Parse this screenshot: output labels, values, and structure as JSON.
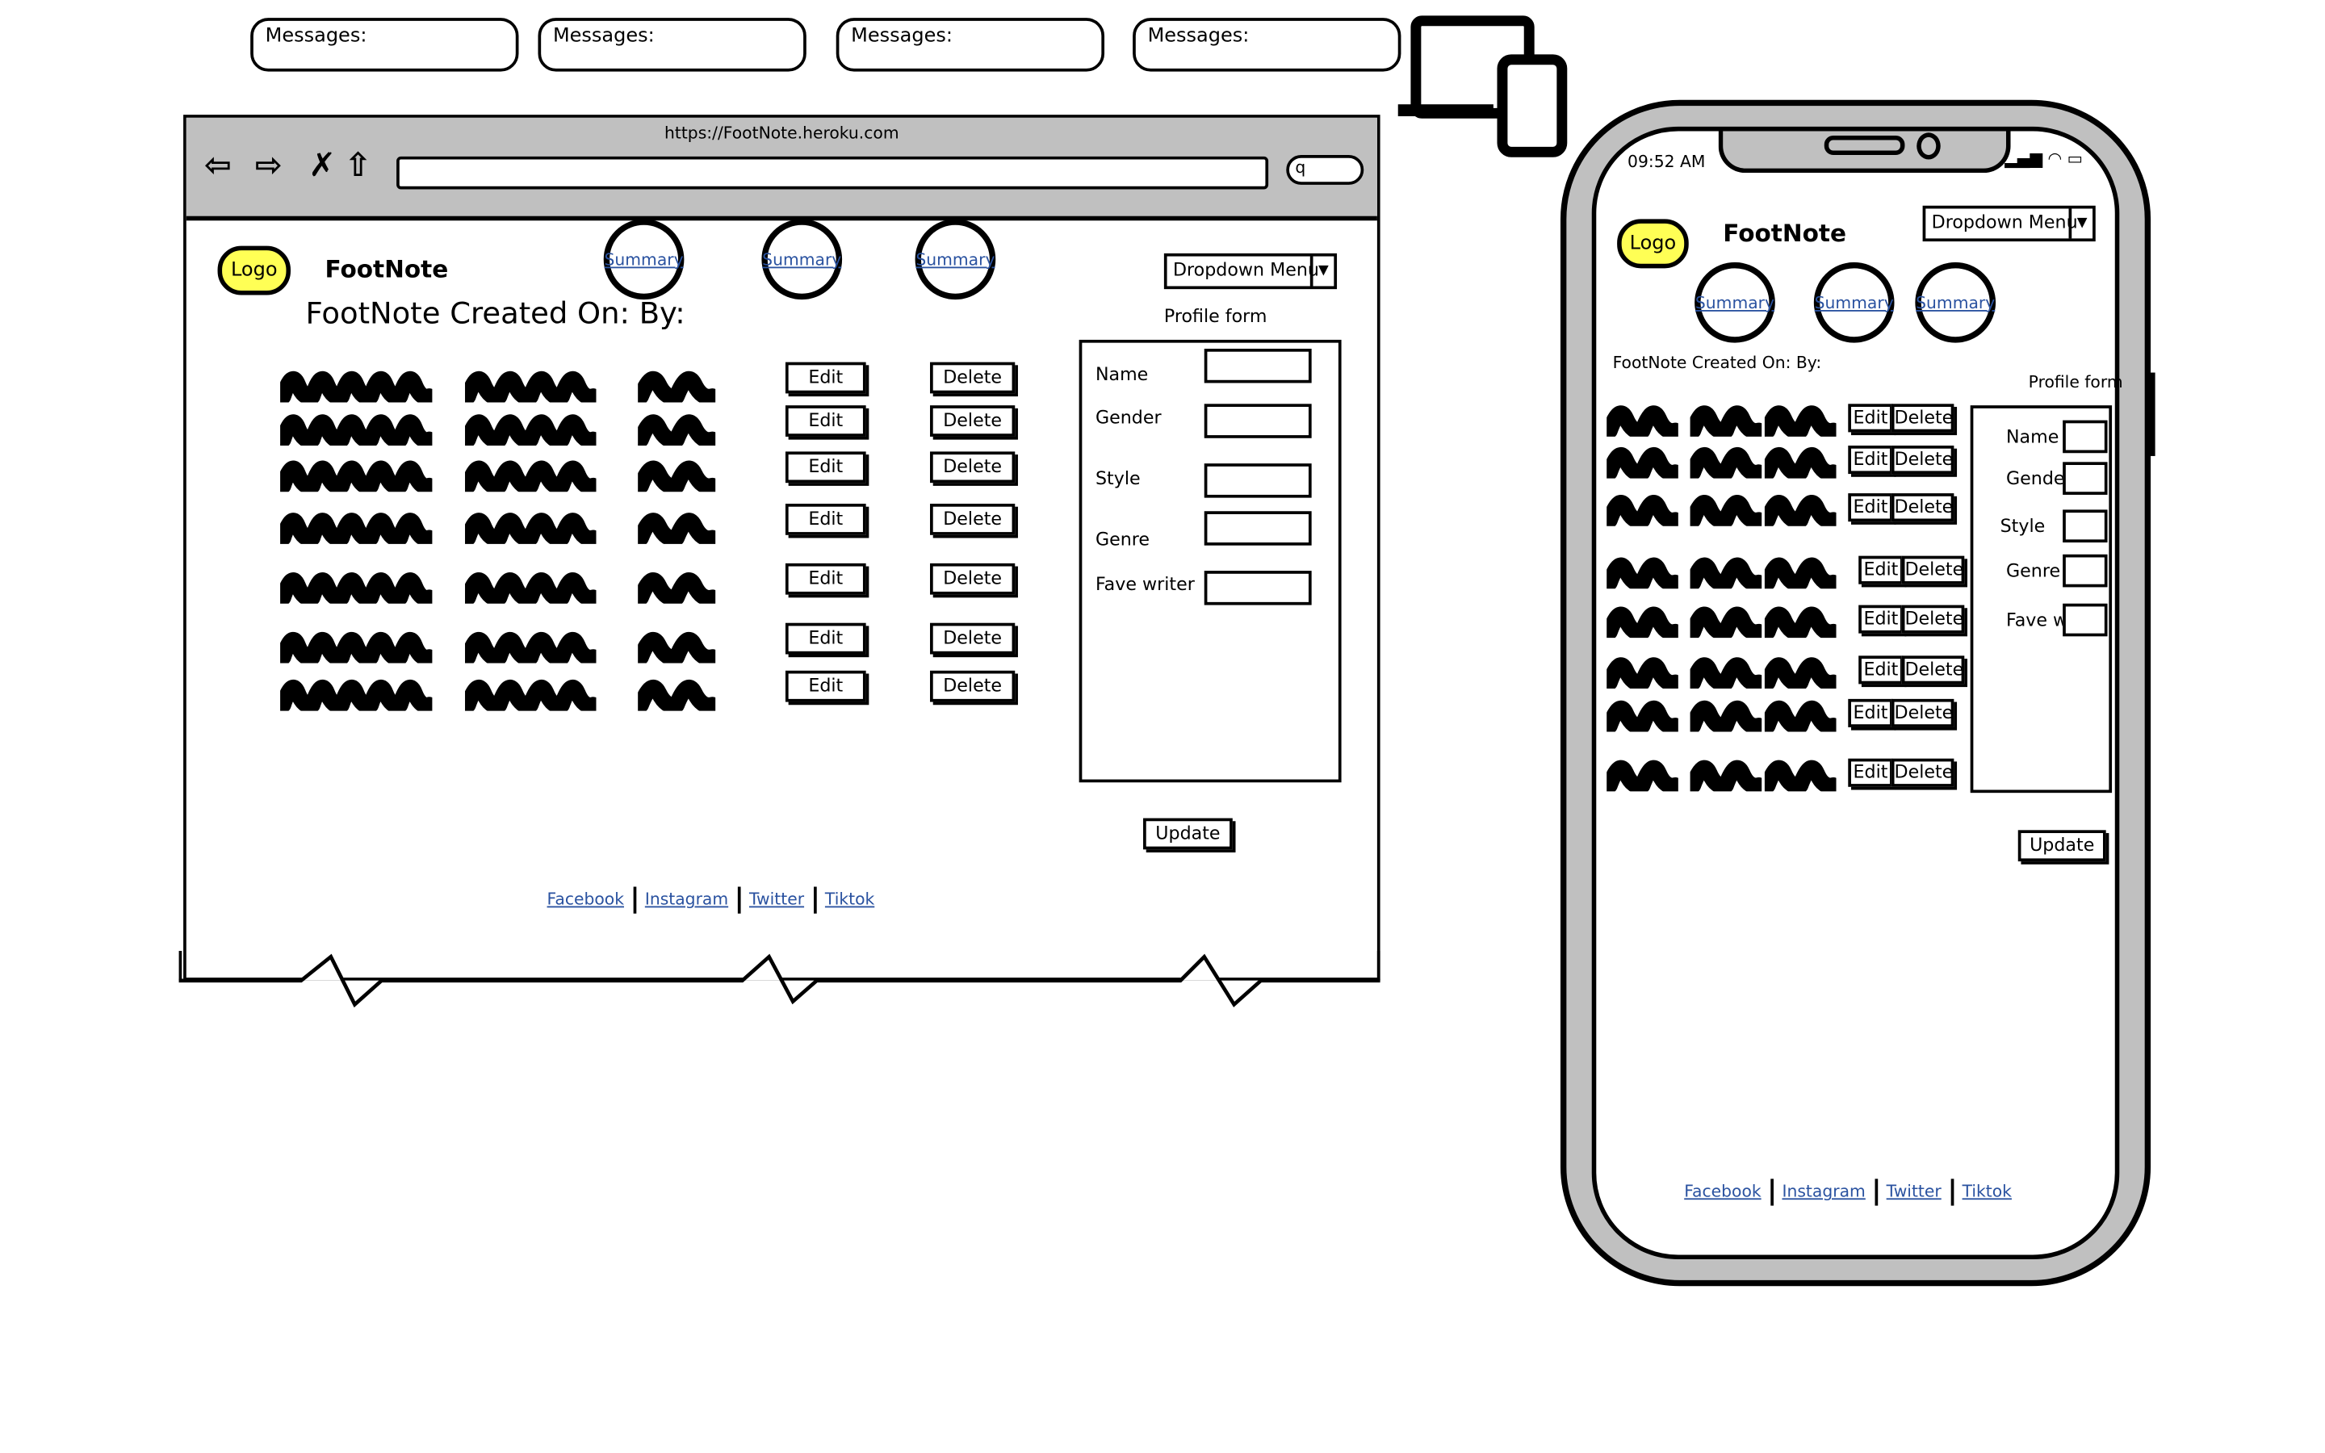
{
  "messages": [
    "Messages:",
    "Messages:",
    "Messages:",
    "Messages:"
  ],
  "browser": {
    "url": "https://FootNote.heroku.com",
    "nav_icons": [
      "back-arrow-icon",
      "forward-arrow-icon",
      "close-icon",
      "home-icon"
    ],
    "search_icon": "q",
    "logo": "Logo",
    "title": "FootNote",
    "summaries": [
      "Summary",
      "Summary",
      "Summary"
    ],
    "dropdown": "Dropdown Menu",
    "created_line": "FootNote Created On:  By:",
    "profile_label": "Profile form",
    "fields": [
      "Name",
      "Gender",
      "Style",
      "Genre",
      "Fave writer"
    ],
    "edit": "Edit",
    "delete": "Delete",
    "row_count": 7,
    "update": "Update",
    "footer": [
      "Facebook",
      "Instagram",
      "Twitter",
      "Tiktok"
    ]
  },
  "phone": {
    "time": "09:52 AM",
    "logo": "Logo",
    "title": "FootNote",
    "dropdown": "Dropdown Menu",
    "summaries": [
      "Summary",
      "Summary",
      "Summary"
    ],
    "created_line": "FootNote Created On:   By:",
    "profile_label": "Profile form",
    "fields": [
      "Name",
      "Gender",
      "Style",
      "Genre",
      "Fave writer"
    ],
    "edit": "Edit",
    "delete": "Delete",
    "row_count": 8,
    "update": "Update",
    "footer": [
      "Facebook",
      "Instagram",
      "Twitter",
      "Tiktok"
    ]
  },
  "colors": {
    "accent": "#ffff55",
    "link": "#2a52a0",
    "chrome": "#c0c0c0"
  }
}
